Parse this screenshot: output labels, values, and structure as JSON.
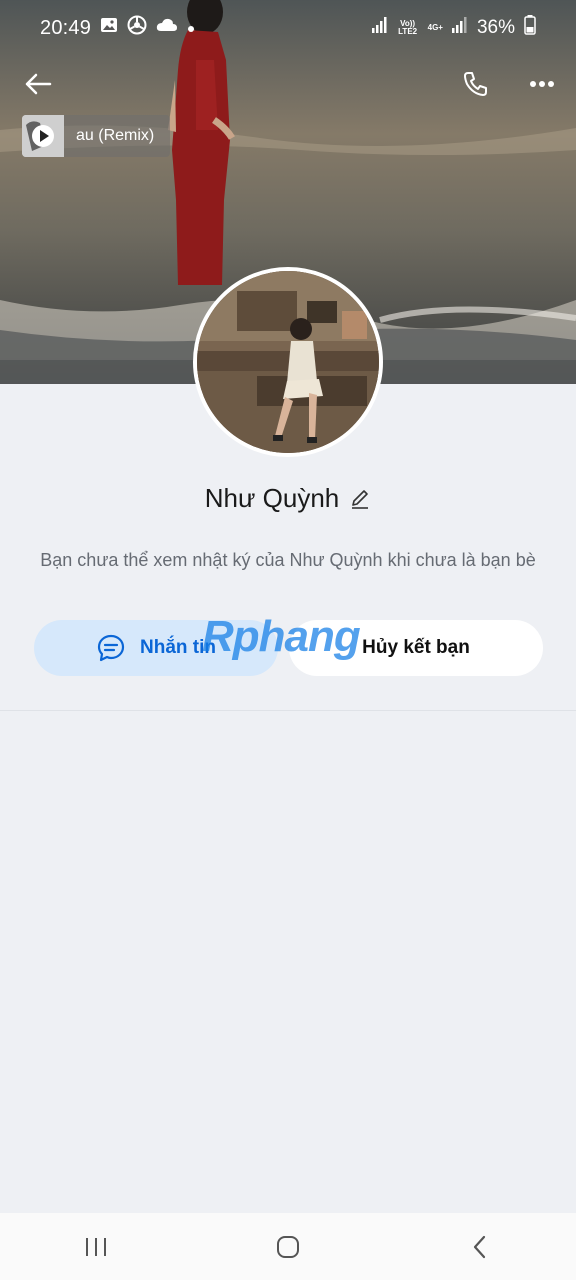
{
  "status_bar": {
    "time": "20:49",
    "network_label_top": "Vo)) LTE2",
    "network_label_4g": "4G+",
    "battery": "36%"
  },
  "music": {
    "title": "au (Remix)"
  },
  "profile": {
    "name": "Như Quỳnh",
    "diary_note": "Bạn chưa thể xem nhật ký của Như Quỳnh khi chưa là bạn bè"
  },
  "actions": {
    "message_label": "Nhắn tin",
    "unfriend_label": "Hủy kết bạn"
  },
  "watermark": "Rphang",
  "colors": {
    "accent": "#0b66d6",
    "message_bg": "#d6e8fb",
    "page_bg": "#eef0f4"
  },
  "icons": [
    "back-arrow-icon",
    "phone-icon",
    "more-icon",
    "play-icon",
    "edit-pencil-icon",
    "chat-bubble-icon",
    "nav-recents-icon",
    "nav-home-icon",
    "nav-back-icon"
  ]
}
